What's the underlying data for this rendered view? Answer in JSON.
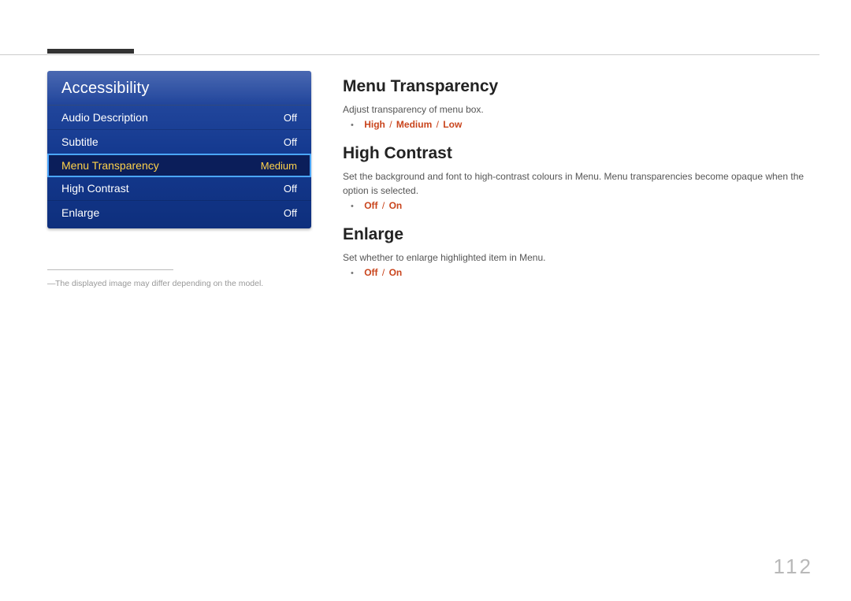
{
  "page_number": "112",
  "footnote": "The displayed image may differ depending on the model.",
  "menu_panel": {
    "title": "Accessibility",
    "rows": [
      {
        "label": "Audio Description",
        "value": "Off",
        "selected": false
      },
      {
        "label": "Subtitle",
        "value": "Off",
        "selected": false
      },
      {
        "label": "Menu Transparency",
        "value": "Medium",
        "selected": true
      },
      {
        "label": "High Contrast",
        "value": "Off",
        "selected": false
      },
      {
        "label": "Enlarge",
        "value": "Off",
        "selected": false
      }
    ]
  },
  "sections": {
    "menu_transparency": {
      "heading": "Menu Transparency",
      "desc": "Adjust transparency of menu box.",
      "options": [
        "High",
        "Medium",
        "Low"
      ]
    },
    "high_contrast": {
      "heading": "High Contrast",
      "desc": "Set the background and font to high-contrast colours in Menu. Menu transparencies become opaque when the option is selected.",
      "options": [
        "Off",
        "On"
      ]
    },
    "enlarge": {
      "heading": "Enlarge",
      "desc": "Set whether to enlarge highlighted item in Menu.",
      "options": [
        "Off",
        "On"
      ]
    }
  }
}
